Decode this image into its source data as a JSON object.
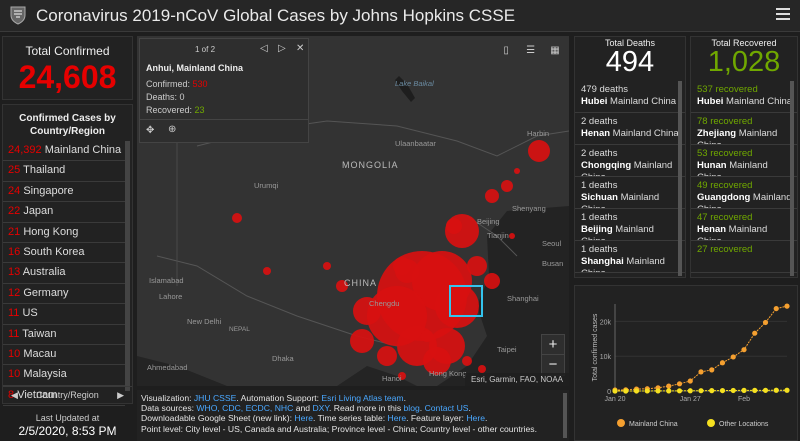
{
  "header": {
    "title": "Coronavirus 2019-nCoV Global Cases by Johns Hopkins CSSE"
  },
  "total_confirmed": {
    "label": "Total Confirmed",
    "value": "24,608"
  },
  "country_list": {
    "header": "Confirmed Cases by Country/Region",
    "rows": [
      {
        "count": "24,392",
        "name": "Mainland China"
      },
      {
        "count": "25",
        "name": "Thailand"
      },
      {
        "count": "24",
        "name": "Singapore"
      },
      {
        "count": "22",
        "name": "Japan"
      },
      {
        "count": "21",
        "name": "Hong Kong"
      },
      {
        "count": "16",
        "name": "South Korea"
      },
      {
        "count": "13",
        "name": "Australia"
      },
      {
        "count": "12",
        "name": "Germany"
      },
      {
        "count": "11",
        "name": "US"
      },
      {
        "count": "11",
        "name": "Taiwan"
      },
      {
        "count": "10",
        "name": "Macau"
      },
      {
        "count": "10",
        "name": "Malaysia"
      },
      {
        "count": "8",
        "name": "Vietnam"
      }
    ],
    "footer": "Country/Region"
  },
  "last_updated": {
    "label": "Last Updated at",
    "value": "2/5/2020, 8:53 PM"
  },
  "map": {
    "popup": {
      "pager": "1 of 2",
      "title": "Anhui, Mainland China",
      "confirmed_label": "Confirmed:",
      "confirmed": "530",
      "deaths_label": "Deaths:",
      "deaths": "0",
      "recovered_label": "Recovered:",
      "recovered": "23"
    },
    "labels": [
      {
        "text": "MONGOLIA",
        "cls": "big"
      },
      {
        "text": "CHINA",
        "cls": "big"
      },
      {
        "text": "Lake Baikal",
        "cls": "water"
      },
      {
        "text": "Ulaanbaatar",
        "cls": "city"
      },
      {
        "text": "Urumqi",
        "cls": "city"
      },
      {
        "text": "Islamabad",
        "cls": "city"
      },
      {
        "text": "Lahore",
        "cls": "city"
      },
      {
        "text": "New Delhi",
        "cls": "city"
      },
      {
        "text": "NEPAL",
        "cls": "city"
      },
      {
        "text": "Dhaka",
        "cls": "city"
      },
      {
        "text": "Ahmedabad",
        "cls": "city"
      },
      {
        "text": "Hanoi",
        "cls": "city"
      },
      {
        "text": "Hong Kong",
        "cls": "city"
      },
      {
        "text": "Taipei",
        "cls": "city"
      },
      {
        "text": "Shanghai",
        "cls": "city"
      },
      {
        "text": "Chengdu",
        "cls": "city"
      },
      {
        "text": "Beijing",
        "cls": "city"
      },
      {
        "text": "Shenyang",
        "cls": "city"
      },
      {
        "text": "Seoul",
        "cls": "city"
      },
      {
        "text": "Busan",
        "cls": "city"
      },
      {
        "text": "Tianjin",
        "cls": "city"
      },
      {
        "text": "Harbin",
        "cls": "city"
      }
    ],
    "attribution": "Esri, Garmin, FAO, NOAA",
    "zoom_in": "+",
    "zoom_out": "−"
  },
  "info": {
    "l1a": "Visualization: ",
    "l1b": "JHU CSSE",
    "l1c": ". Automation Support: ",
    "l1d": "Esri Living Atlas team",
    "l1e": ".",
    "l2a": "Data sources: ",
    "l2b": "WHO, CDC, ECDC, NHC",
    "l2c": " and ",
    "l2d": "DXY",
    "l2e": ". Read more in this ",
    "l2f": "blog",
    "l2g": ". ",
    "l2h": "Contact US",
    "l2i": ".",
    "l3a": "Downloadable Google Sheet (new link): ",
    "l3b": "Here",
    "l3c": ". Time series table: ",
    "l3d": "Here",
    "l3e": ". Feature layer: ",
    "l3f": "Here",
    "l3g": ".",
    "l4": "Point level: City level - US, Canada and Australia; Province level - China; Country level - other countries."
  },
  "deaths": {
    "label": "Total Deaths",
    "value": "494",
    "items": [
      {
        "count": "479 deaths",
        "name": "Hubei",
        "region": " Mainland China"
      },
      {
        "count": "2 deaths",
        "name": "Henan",
        "region": " Mainland China"
      },
      {
        "count": "2 deaths",
        "name": "Chongqing",
        "region": " Mainland China"
      },
      {
        "count": "1 deaths",
        "name": "Sichuan",
        "region": " Mainland China"
      },
      {
        "count": "1 deaths",
        "name": "Beijing",
        "region": " Mainland China"
      },
      {
        "count": "1 deaths",
        "name": "Shanghai",
        "region": " Mainland China"
      }
    ]
  },
  "recovered": {
    "label": "Total Recovered",
    "value": "1,028",
    "items": [
      {
        "count": "537 recovered",
        "name": "Hubei",
        "region": " Mainland China"
      },
      {
        "count": "78 recovered",
        "name": "Zhejiang",
        "region": " Mainland China"
      },
      {
        "count": "53 recovered",
        "name": "Hunan",
        "region": " Mainland China"
      },
      {
        "count": "49 recovered",
        "name": "Guangdong",
        "region": " Mainland China"
      },
      {
        "count": "47 recovered",
        "name": "Henan",
        "region": " Mainland China"
      },
      {
        "count": "27 recovered",
        "name": "",
        "region": ""
      }
    ]
  },
  "colors": {
    "confirmed": "#e60000",
    "recovered": "#70a800",
    "mainland": "#f5a030",
    "other": "#f5e020"
  },
  "chart_data": {
    "type": "line",
    "ylabel": "Total confirmed cases",
    "x": [
      "Jan 20",
      "Jan 21",
      "Jan 22",
      "Jan 23",
      "Jan 24",
      "Jan 25",
      "Jan 26",
      "Jan 27",
      "Jan 28",
      "Jan 29",
      "Jan 30",
      "Jan 31",
      "Feb 1",
      "Feb 2",
      "Feb 3",
      "Feb 4",
      "Feb 5"
    ],
    "xticks": [
      "Jan 20",
      "Jan 27",
      "Feb"
    ],
    "yticks": [
      "0",
      "10k",
      "20k"
    ],
    "ylim": [
      0,
      25000
    ],
    "series": [
      {
        "name": "Mainland China",
        "values": [
          278,
          326,
          547,
          639,
          916,
          1399,
          2062,
          2863,
          5494,
          6070,
          8124,
          9783,
          11871,
          16607,
          19693,
          23680,
          24392
        ]
      },
      {
        "name": "Other Locations",
        "values": [
          4,
          6,
          8,
          14,
          25,
          40,
          57,
          64,
          87,
          105,
          118,
          153,
          173,
          183,
          188,
          212,
          216
        ]
      }
    ]
  }
}
